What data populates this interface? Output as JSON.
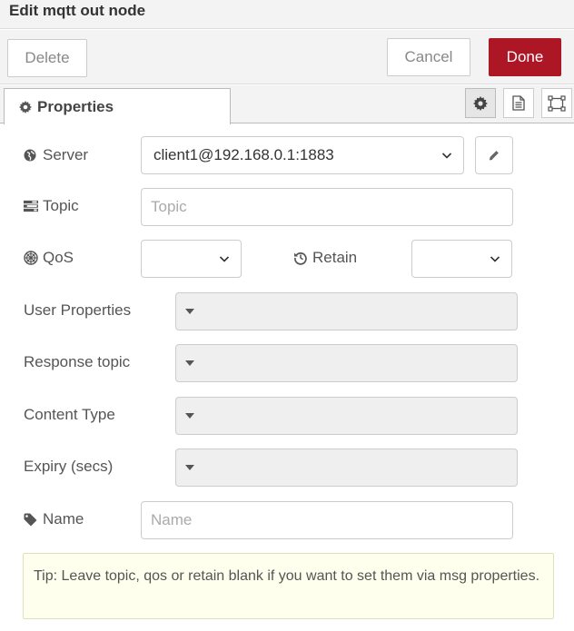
{
  "window": {
    "title": "Edit mqtt out node"
  },
  "toolbar": {
    "delete_label": "Delete",
    "cancel_label": "Cancel",
    "done_label": "Done",
    "done_color": "#ad1625"
  },
  "tabs": {
    "properties_label": "Properties",
    "icons": [
      "gear-icon",
      "description-icon",
      "appearance-icon"
    ]
  },
  "form": {
    "server": {
      "label": "Server",
      "value": "client1@192.168.0.1:1883",
      "icon": "globe-icon"
    },
    "topic": {
      "label": "Topic",
      "placeholder": "Topic",
      "value": "",
      "icon": "tasks-icon"
    },
    "qos": {
      "label": "QoS",
      "value": "",
      "icon": "empire-icon"
    },
    "retain": {
      "label": "Retain",
      "value": "",
      "icon": "history-icon"
    },
    "user_properties": {
      "label": "User Properties"
    },
    "response_topic": {
      "label": "Response topic"
    },
    "content_type": {
      "label": "Content Type"
    },
    "expiry": {
      "label": "Expiry (secs)"
    },
    "name": {
      "label": "Name",
      "placeholder": "Name",
      "value": "",
      "icon": "tag-icon"
    }
  },
  "tip": {
    "text": "Tip: Leave topic, qos or retain blank if you want to set them via msg properties."
  }
}
